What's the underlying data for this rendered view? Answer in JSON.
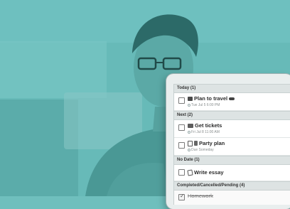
{
  "sections": {
    "today": "Today (1)",
    "next": "Next (2)",
    "no_date": "No Date (1)",
    "completed": "Completed/Cancelled/Pending (4)"
  },
  "tasks": {
    "plan_travel": {
      "title": "Plan to travel",
      "meta": "Tue Jul 5  6:00 PM"
    },
    "get_tickets": {
      "title": "Get tickets",
      "meta": "Fri Jul 8  11:00 AM"
    },
    "party_plan": {
      "title": "Party plan",
      "meta": "Due Someday"
    },
    "write_essay": {
      "title": "Write essay"
    },
    "homework": {
      "title": "Homework"
    }
  },
  "icons": {
    "plan_travel": "suitcase-icon",
    "plan_travel_trailing": "car-icon",
    "get_tickets": "tag-icon",
    "party_plan_1": "list-icon",
    "party_plan_2": "party-icon",
    "write_essay": "edit-icon",
    "meta": "clock-icon"
  },
  "colors": {
    "overlay": "#6fbfbd",
    "screen": "#ffffff",
    "section_header": "#dde3e3"
  }
}
